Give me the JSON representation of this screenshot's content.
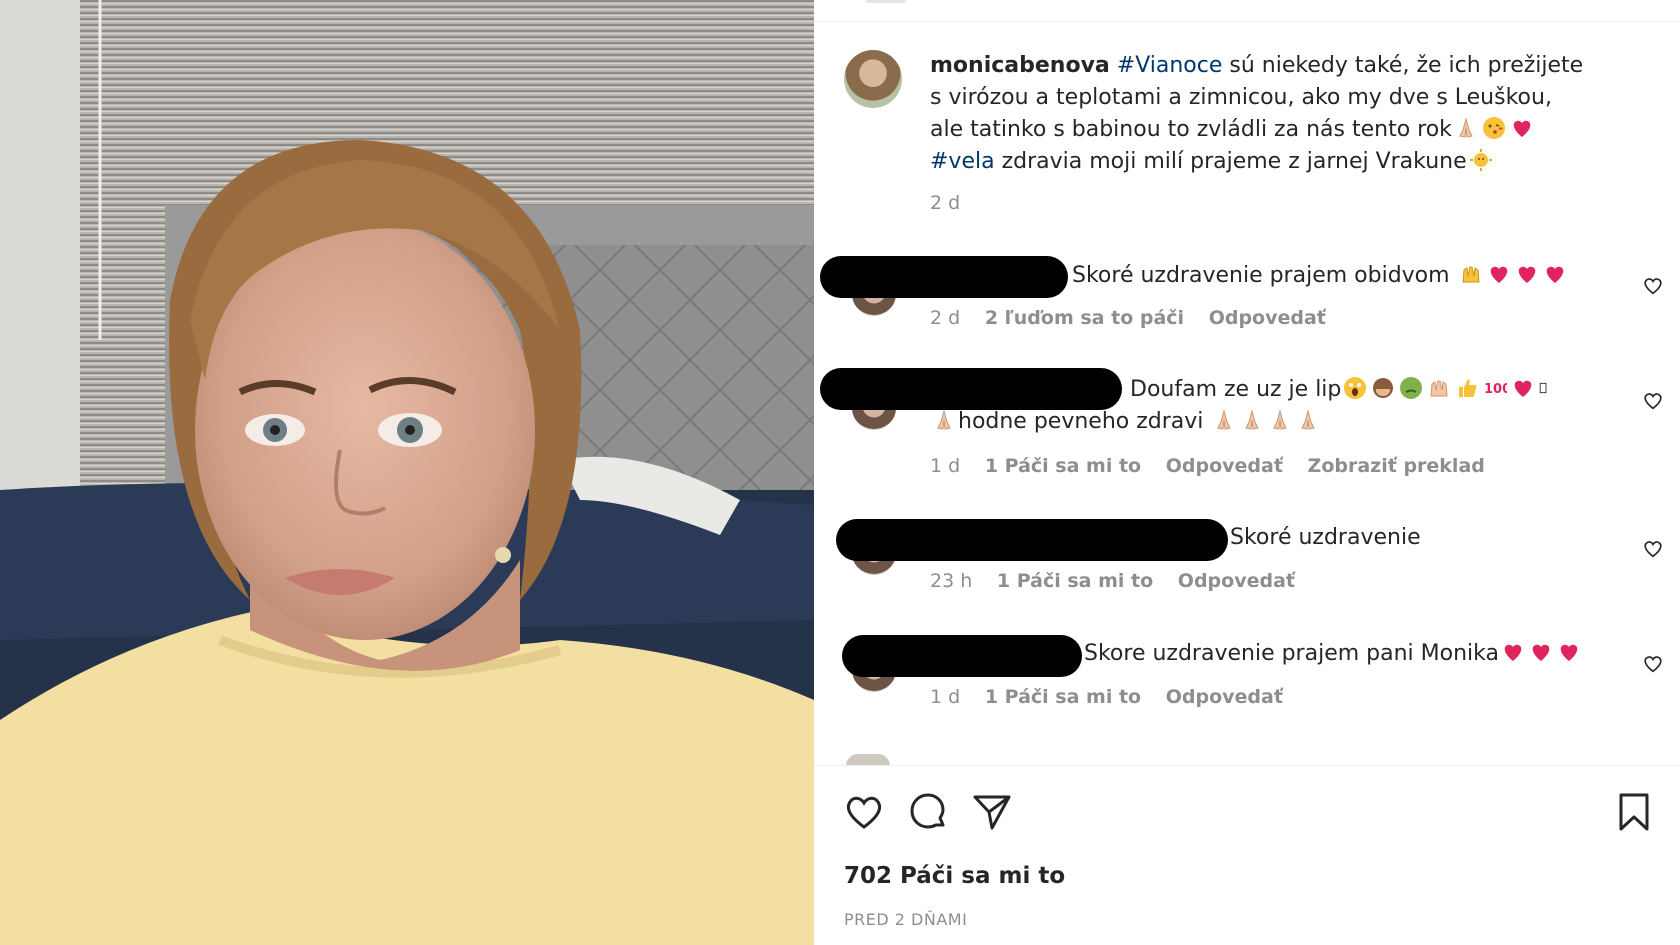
{
  "post": {
    "username": "monicabenova",
    "caption_hashtag_1": "#Vianoce",
    "caption_part_1": " sú niekedy také, že ich prežijete s virózou a teplotami a zimnicou, ako my dve s Leuškou, ale tatinko s babinou to zvládli za nás tento rok",
    "caption_hashtag_2": "#vela",
    "caption_part_2": "zdravia moji milí prajeme z jarnej Vrakune",
    "time": "2 d"
  },
  "comments": [
    {
      "text": "Skoré uzdravenie prajem obidvom",
      "time": "2 d",
      "likes": "2 ľuďom sa to páči",
      "reply": "Odpovedať",
      "translate": ""
    },
    {
      "text": "Doufam ze uz je lip",
      "text_line2": "hodne pevneho zdravi",
      "time": "1 d",
      "likes": "1 Páči sa mi to",
      "reply": "Odpovedať",
      "translate": "Zobraziť preklad"
    },
    {
      "text": "Skoré uzdravenie",
      "time": "23 h",
      "likes": "1 Páči sa mi to",
      "reply": "Odpovedať",
      "translate": ""
    },
    {
      "text": "Skore uzdravenie prajem pani Monika",
      "time": "1 d",
      "likes": "1 Páči sa mi to",
      "reply": "Odpovedať",
      "translate": ""
    }
  ],
  "footer": {
    "likes": "702 Páči sa mi to",
    "ago": "PRED 2 DŇAMI"
  },
  "icons": {
    "like": "heart-icon",
    "comment": "comment-bubble-icon",
    "share": "paper-plane-icon",
    "save": "bookmark-icon"
  },
  "colors": {
    "text": "#262626",
    "muted": "#8e8e8e",
    "hashtag": "#00376b",
    "heart_red": "#e0245e"
  }
}
